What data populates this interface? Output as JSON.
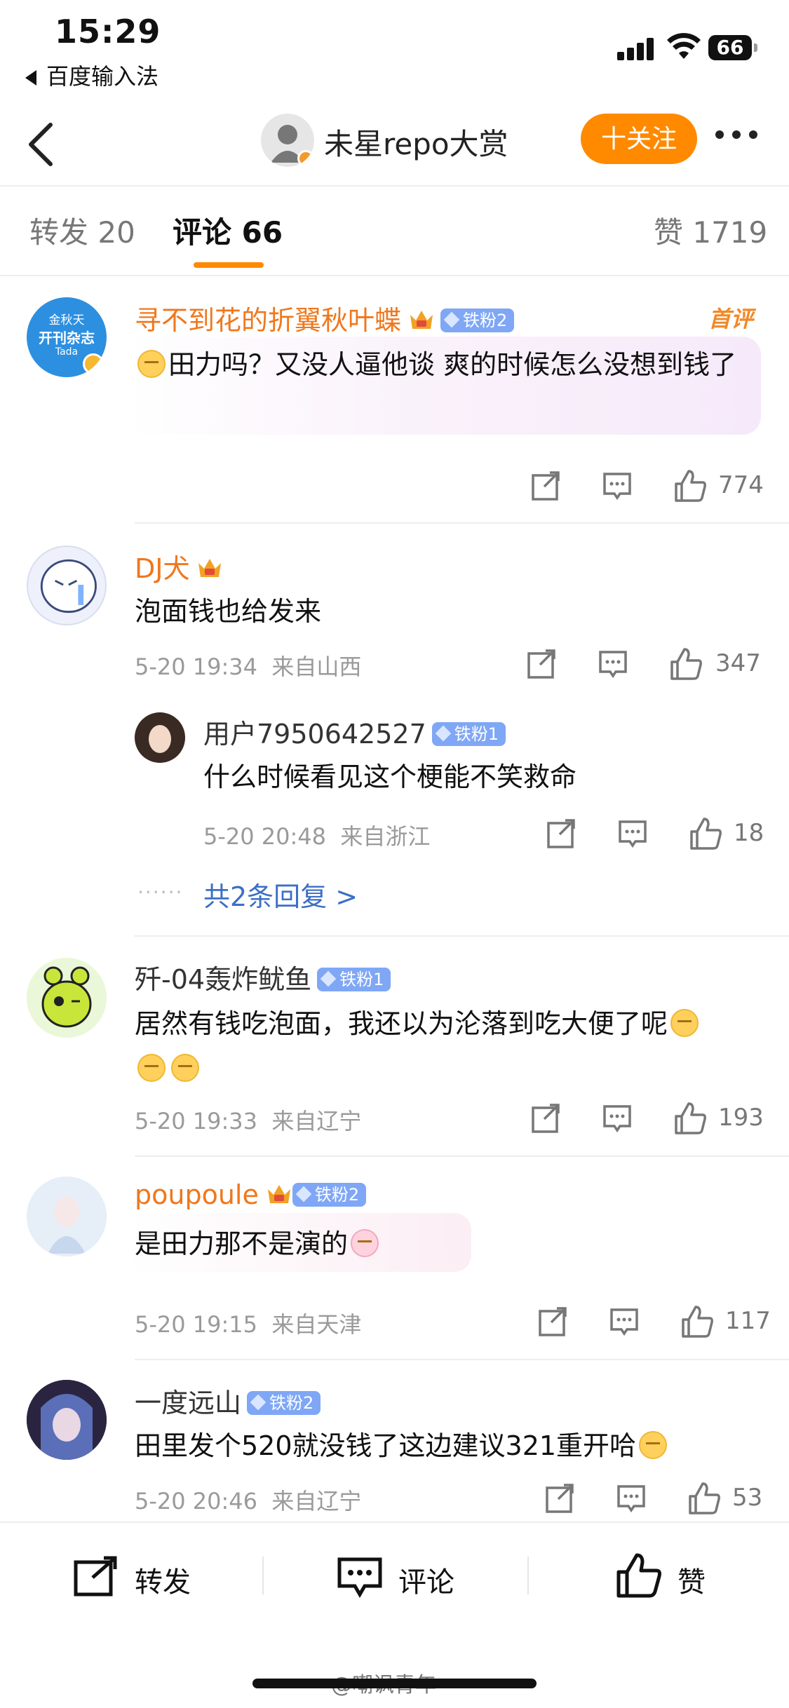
{
  "status_bar": {
    "time": "15:29",
    "back_app": "百度输入法",
    "battery": "66"
  },
  "nav": {
    "title": "未星repo大赏",
    "follow_label": "十关注"
  },
  "tabs": [
    {
      "label": "转发 20"
    },
    {
      "label": "评论 66"
    },
    {
      "label": "赞 1719"
    }
  ],
  "comments": [
    {
      "user": "寻不到花的折翼秋叶蝶",
      "badge": "铁粉2",
      "hot_tag": "首评",
      "text": "田力吗？又没人逼他谈 爽的时候怎么没想到钱了",
      "likes": "774",
      "avatar_lines": [
        "金秋天",
        "开刊杂志",
        "Tada"
      ]
    },
    {
      "user": "DJ犬",
      "text": "泡面钱也给发来",
      "time": "5-20 19:34",
      "location": "来自山西",
      "likes": "347",
      "reply": {
        "user": "用户7950642527",
        "badge": "铁粉1",
        "text": "什么时候看见这个梗能不笑救命",
        "time": "5-20 20:48",
        "location": "来自浙江",
        "likes": "18"
      },
      "more_replies": "共2条回复 >"
    },
    {
      "user": "歼-04轰炸鱿鱼",
      "badge": "铁粉1",
      "text": "居然有钱吃泡面，我还以为沦落到吃大便了呢",
      "time": "5-20 19:33",
      "location": "来自辽宁",
      "likes": "193"
    },
    {
      "user": "poupoule",
      "badge": "铁粉2",
      "text": "是田力那不是演的",
      "time": "5-20 19:15",
      "location": "来自天津",
      "likes": "117"
    },
    {
      "user": "一度远山",
      "badge": "铁粉2",
      "text": "田里发个520就没钱了这边建议321重开哈",
      "time": "5-20 20:46",
      "location": "来自辽宁",
      "likes": "53"
    }
  ],
  "toolbar": {
    "repost": "转发",
    "comment": "评论",
    "like": "赞"
  },
  "watermark": "@嘲讽青年",
  "colors": {
    "accent": "#ff8a00",
    "username_orange": "#f0771c",
    "link_blue": "#3c6fc6",
    "fan_badge": "#7fa7f5"
  }
}
